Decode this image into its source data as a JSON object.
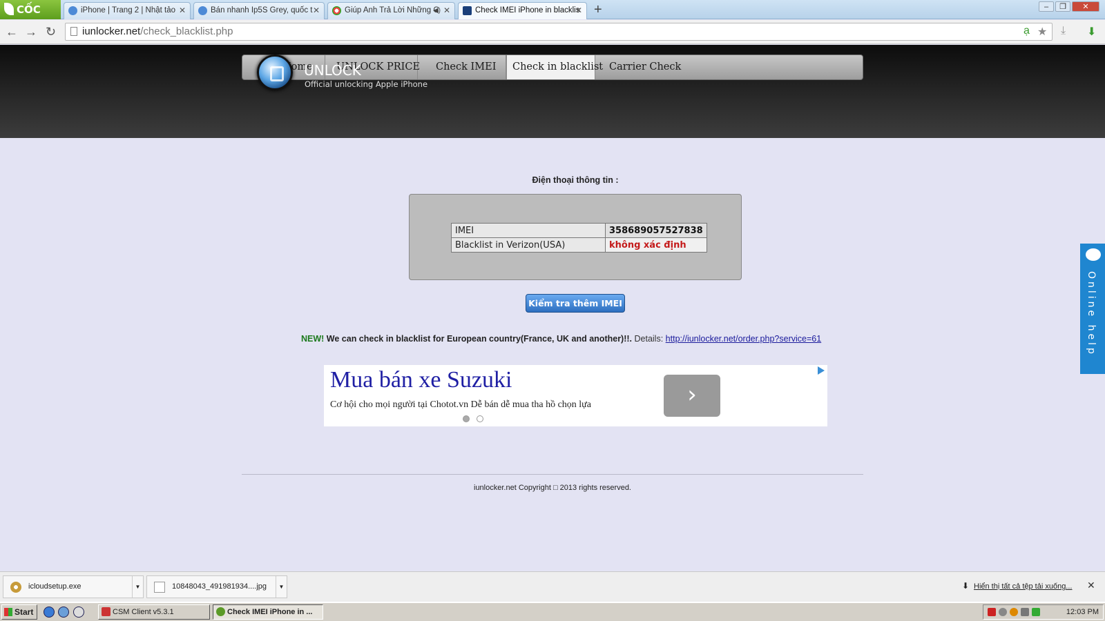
{
  "browser": {
    "brand": "CỐC CỐC",
    "tabs": [
      {
        "title": "iPhone | Trang 2 | Nhật tảo",
        "active": false
      },
      {
        "title": "Bán nhanh Ip5S Grey, quốc t",
        "active": false
      },
      {
        "title": "Giúp Anh Trả Lời Những C",
        "active": false,
        "audio": true
      },
      {
        "title": "Check IMEI iPhone in blacklis",
        "active": true
      }
    ],
    "url_host": "iunlocker.net",
    "url_path": "/check_blacklist.php",
    "icons": [
      "back-icon",
      "forward-icon",
      "reload-icon",
      "page-icon",
      "star-icon",
      "download-icon"
    ]
  },
  "site": {
    "nav": [
      {
        "label": "Home",
        "icon": "home-icon"
      },
      {
        "label": "UNLOCK PRICE"
      },
      {
        "label": "Check IMEI"
      },
      {
        "label": "Check in blacklist",
        "active": true
      },
      {
        "label": "Carrier Check"
      }
    ],
    "title": "UNLOCK",
    "subtitle": "Official unlocking Apple iPhone"
  },
  "main": {
    "heading": "Điện thoại thông tin :",
    "rows": [
      {
        "key": "IMEI",
        "value": "358689057527838"
      },
      {
        "key": "Blacklist in Verizon(USA)",
        "value": "không xác định"
      }
    ],
    "button": "Kiểm tra thêm IMEI",
    "notice": {
      "new": "NEW!",
      "message": " We can check in blacklist for European country(France, UK and another)!!.",
      "details": " Details: ",
      "link": "http://iunlocker.net/order.php?service=61"
    },
    "ad": {
      "title": "Mua bán xe Suzuki",
      "text": "Cơ hội cho mọi người tại Chotot.vn Dễ bán dễ mua tha hồ chọn lựa",
      "arrow": "›"
    },
    "footer": "iunlocker.net Copyright □ 2013 rights reserved."
  },
  "online_help": "Online help",
  "downloads": {
    "items": [
      "icloudsetup.exe",
      "10848043_491981934....jpg"
    ],
    "show_all": "Hiển thị tất cả tệp tải xuống..."
  },
  "taskbar": {
    "start": "Start",
    "buttons": [
      "CSM Client v5.3.1",
      "Check IMEI iPhone in ..."
    ],
    "clock": "12:03 PM"
  },
  "colors": {
    "accent_blue": "#2d6fc0",
    "status_red": "#c41a1a",
    "new_green": "#1d7a1d",
    "help_blue": "#1f86d0"
  }
}
